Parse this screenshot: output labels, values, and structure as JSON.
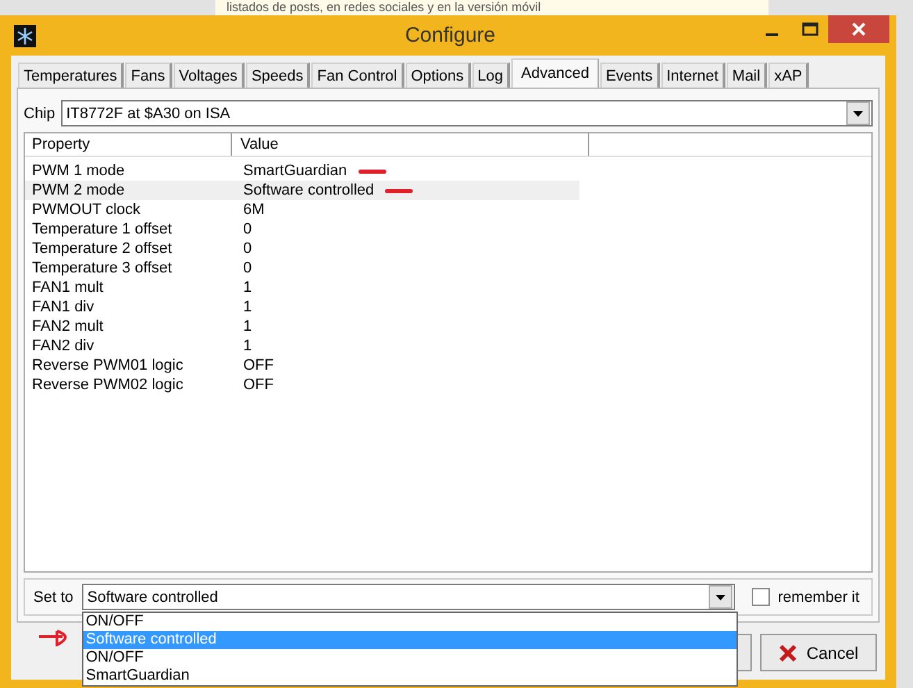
{
  "background_text": "listados de posts, en redes sociales y en la versión móvil",
  "window": {
    "title": "Configure"
  },
  "tabs": [
    {
      "label": "Temperatures",
      "selected": false
    },
    {
      "label": "Fans",
      "selected": false
    },
    {
      "label": "Voltages",
      "selected": false
    },
    {
      "label": "Speeds",
      "selected": false
    },
    {
      "label": "Fan Control",
      "selected": false
    },
    {
      "label": "Options",
      "selected": false
    },
    {
      "label": "Log",
      "selected": false
    },
    {
      "label": "Advanced",
      "selected": true
    },
    {
      "label": "Events",
      "selected": false
    },
    {
      "label": "Internet",
      "selected": false
    },
    {
      "label": "Mail",
      "selected": false
    },
    {
      "label": "xAP",
      "selected": false
    }
  ],
  "chip": {
    "label": "Chip",
    "value": "IT8772F at $A30 on ISA"
  },
  "table": {
    "columns": [
      "Property",
      "Value"
    ],
    "rows": [
      {
        "property": "PWM 1 mode",
        "value": "SmartGuardian",
        "selected": false,
        "marked": true
      },
      {
        "property": "PWM 2 mode",
        "value": "Software controlled",
        "selected": true,
        "marked": true
      },
      {
        "property": "PWMOUT clock",
        "value": "6M",
        "selected": false,
        "marked": false
      },
      {
        "property": "Temperature 1 offset",
        "value": "0",
        "selected": false,
        "marked": false
      },
      {
        "property": "Temperature 2 offset",
        "value": "0",
        "selected": false,
        "marked": false
      },
      {
        "property": "Temperature 3 offset",
        "value": "0",
        "selected": false,
        "marked": false
      },
      {
        "property": "FAN1 mult",
        "value": "1",
        "selected": false,
        "marked": false
      },
      {
        "property": "FAN1 div",
        "value": "1",
        "selected": false,
        "marked": false
      },
      {
        "property": "FAN2 mult",
        "value": "1",
        "selected": false,
        "marked": false
      },
      {
        "property": "FAN2 div",
        "value": "1",
        "selected": false,
        "marked": false
      },
      {
        "property": "Reverse PWM01 logic",
        "value": "OFF",
        "selected": false,
        "marked": false
      },
      {
        "property": "Reverse PWM02 logic",
        "value": "OFF",
        "selected": false,
        "marked": false
      }
    ]
  },
  "set_to": {
    "label": "Set to",
    "value": "Software controlled",
    "options": [
      {
        "label": "ON/OFF",
        "selected": false,
        "marked": false
      },
      {
        "label": "Software controlled",
        "selected": true,
        "marked": true
      },
      {
        "label": "ON/OFF",
        "selected": false,
        "marked": false
      },
      {
        "label": "SmartGuardian",
        "selected": false,
        "marked": false
      }
    ]
  },
  "remember": {
    "label": "remember it",
    "checked": false
  },
  "cancel_button": {
    "label": "Cancel"
  }
}
